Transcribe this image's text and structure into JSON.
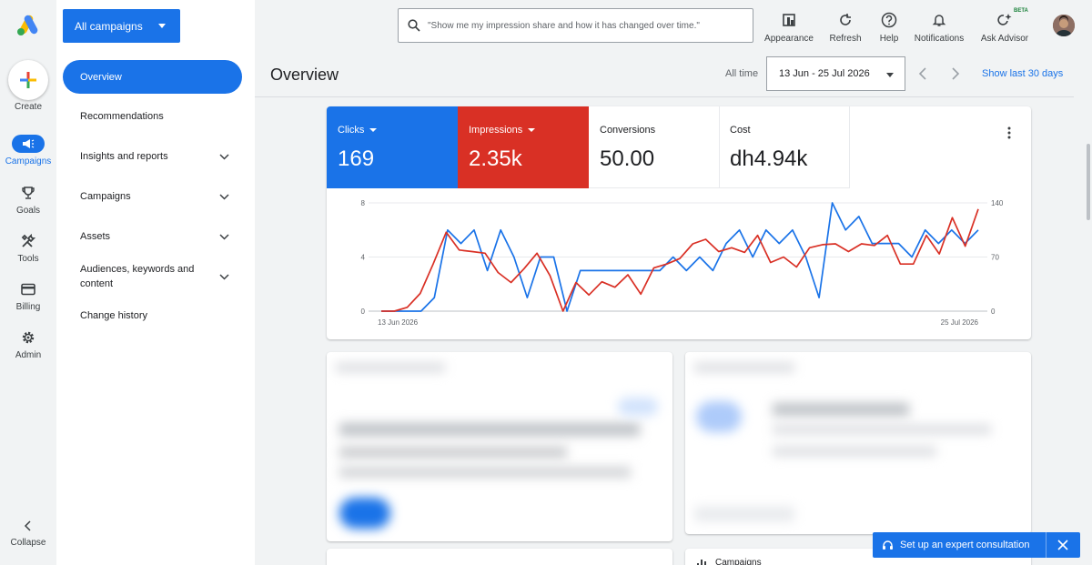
{
  "rail": {
    "create_label": "Create",
    "items": [
      {
        "label": "Campaigns",
        "icon": "megaphone-icon",
        "active": true
      },
      {
        "label": "Goals",
        "icon": "trophy-icon"
      },
      {
        "label": "Tools",
        "icon": "tools-icon"
      },
      {
        "label": "Billing",
        "icon": "credit-card-icon"
      },
      {
        "label": "Admin",
        "icon": "gear-icon"
      }
    ],
    "collapse_label": "Collapse"
  },
  "nav": {
    "scope_label": "All campaigns",
    "items": [
      {
        "label": "Overview",
        "active": true
      },
      {
        "label": "Recommendations"
      },
      {
        "label": "Insights and reports",
        "expandable": true
      },
      {
        "label": "Campaigns",
        "expandable": true
      },
      {
        "label": "Assets",
        "expandable": true
      },
      {
        "label": "Audiences, keywords and content",
        "expandable": true
      },
      {
        "label": "Change history"
      }
    ]
  },
  "header": {
    "search_placeholder": "\"Show me my impression share and how it has changed over time.\"",
    "tools": [
      {
        "label": "Appearance",
        "icon": "appearance-icon"
      },
      {
        "label": "Refresh",
        "icon": "refresh-icon"
      },
      {
        "label": "Help",
        "icon": "help-icon"
      },
      {
        "label": "Notifications",
        "icon": "bell-icon"
      },
      {
        "label": "Ask Advisor",
        "icon": "advisor-icon"
      }
    ],
    "beta_badge": "BETA"
  },
  "page": {
    "title": "Overview",
    "range_label": "All time",
    "date_range": "13 Jun - 25 Jul 2026",
    "show_last": "Show last 30 days"
  },
  "metrics": [
    {
      "name": "Clicks",
      "value": "169",
      "color": "#1a73e8",
      "dropdown": true
    },
    {
      "name": "Impressions",
      "value": "2.35k",
      "color": "#d93025",
      "dropdown": true
    },
    {
      "name": "Conversions",
      "value": "50.00"
    },
    {
      "name": "Cost",
      "value": "dh4.94k"
    }
  ],
  "chart_data": {
    "type": "line",
    "x_start_label": "13 Jun 2026",
    "x_end_label": "25 Jul 2026",
    "left_axis": {
      "ticks": [
        "0",
        "4",
        "8"
      ],
      "ylim": [
        0,
        8
      ]
    },
    "right_axis": {
      "ticks": [
        "0",
        "70",
        "140"
      ],
      "ylim": [
        0,
        140
      ]
    },
    "grid": true,
    "series": [
      {
        "name": "Clicks",
        "axis": "left",
        "color": "#1a73e8",
        "values": [
          0,
          0,
          0,
          0,
          1,
          6,
          5,
          6,
          3,
          6,
          4,
          1,
          4,
          4,
          0,
          3,
          3,
          3,
          3,
          3,
          3,
          3,
          4,
          3,
          4,
          3,
          5,
          6,
          4,
          6,
          5,
          6,
          4,
          1,
          8,
          6,
          7,
          5,
          5,
          5,
          4,
          6,
          5,
          6,
          5,
          6
        ]
      },
      {
        "name": "Impressions",
        "axis": "right",
        "color": "#d93025",
        "values": [
          0,
          0,
          5,
          23,
          61,
          102,
          79,
          77,
          75,
          50,
          37,
          55,
          75,
          46,
          0,
          37,
          21,
          38,
          31,
          47,
          22,
          56,
          61,
          68,
          87,
          93,
          77,
          82,
          76,
          98,
          63,
          70,
          57,
          82,
          86,
          87,
          77,
          87,
          85,
          98,
          61,
          61,
          98,
          74,
          121,
          84,
          132
        ]
      }
    ]
  },
  "consult": {
    "label": "Set up an expert consultation"
  },
  "blurred": {
    "campaigns_label": "Campaigns"
  }
}
